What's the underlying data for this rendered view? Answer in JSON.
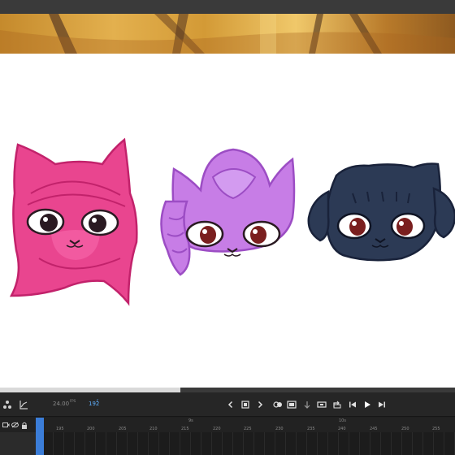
{
  "app": {
    "accent_color": "#3b7dd8",
    "stage_background": "#ffffff"
  },
  "stage": {
    "characters": [
      {
        "name": "pink-cat-character",
        "fill": "#e9458f",
        "outline": "#c2226b"
      },
      {
        "name": "lilac-cat-character",
        "fill": "#c77de6",
        "outline": "#9c4dc4"
      },
      {
        "name": "navy-cat-character",
        "fill": "#2c3a55",
        "outline": "#19223a"
      }
    ]
  },
  "timeline": {
    "fps_value": "24.00",
    "fps_unit": "FPS",
    "current_frame": "192",
    "frame_unit": "F",
    "time_markers": [
      "9s",
      "10s"
    ],
    "frame_ticks": [
      "195",
      "200",
      "205",
      "210",
      "215",
      "220",
      "225",
      "230",
      "235",
      "240",
      "245",
      "250",
      "255"
    ],
    "icons": {
      "layers": "layers-icon",
      "graph": "graph-icon",
      "prev_frame": "chevron-left-icon",
      "stop": "stop-icon",
      "next_frame": "chevron-right-icon",
      "onion_skin": "onion-skin-icon",
      "onion_frames": "onion-frames-icon",
      "insert_frame": "insert-frame-icon",
      "loop": "loop-icon",
      "step_back": "step-back-icon",
      "play": "play-icon",
      "step_forward": "step-forward-icon",
      "camera": "camera-icon",
      "hide_layer": "hide-layer-icon",
      "lock_layer": "lock-icon"
    }
  }
}
